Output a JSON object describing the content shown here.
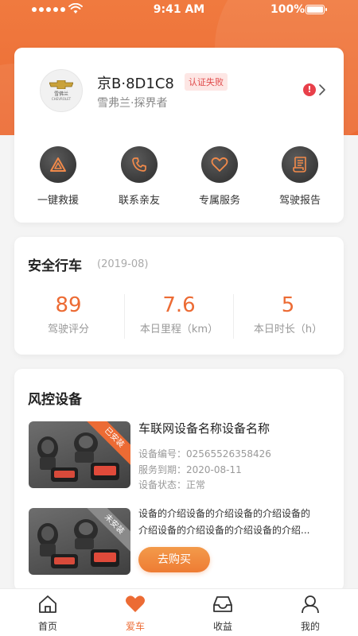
{
  "status_bar": {
    "time": "9:41 AM",
    "battery": "100%"
  },
  "car": {
    "brand_logo_text": "雪佛兰",
    "brand_logo_subtext": "CHEVROLET",
    "plate": "京B·8D1C8",
    "auth_status": "认证失败",
    "model": "雪弗兰·探界者",
    "alert_mark": "!"
  },
  "quick_actions": [
    {
      "label": "一键救援",
      "icon": "warning-triangle-icon"
    },
    {
      "label": "联系亲友",
      "icon": "phone-icon"
    },
    {
      "label": "专属服务",
      "icon": "heart-icon"
    },
    {
      "label": "驾驶报告",
      "icon": "scroll-report-icon"
    }
  ],
  "safety": {
    "title": "安全行车",
    "period": "(2019-08)",
    "stats": [
      {
        "value": "89",
        "caption": "驾驶评分"
      },
      {
        "value": "7.6",
        "caption": "本日里程（km）"
      },
      {
        "value": "5",
        "caption": "本日时长（h）"
      }
    ]
  },
  "devices": {
    "title": "风控设备",
    "installed": {
      "ribbon": "已安装",
      "name": "车联网设备名称设备名称",
      "serial": "设备编号：02565526358426",
      "expiry": "服务到期：2020-08-11",
      "state": "设备状态：正常"
    },
    "not_installed": {
      "ribbon": "未安装",
      "desc_line1": "设备的介绍设备的介绍设备的介绍设备的",
      "desc_line2": "介绍设备的介绍设备的介绍设备的介绍...",
      "buy_label": "去购买"
    }
  },
  "tabbar": [
    {
      "label": "首页",
      "icon": "home-icon"
    },
    {
      "label": "爱车",
      "icon": "heart-filled-icon",
      "active": true
    },
    {
      "label": "收益",
      "icon": "inbox-icon"
    },
    {
      "label": "我的",
      "icon": "user-icon"
    }
  ],
  "colors": {
    "accent": "#ec6b34",
    "hero_bg": "#f07a3f",
    "alert": "#e8404a",
    "badge_text": "#e04a4a",
    "badge_bg": "#fde6e4",
    "ribbon_installed": "#ec6b34",
    "ribbon_not_installed": "#8a8a8a"
  }
}
